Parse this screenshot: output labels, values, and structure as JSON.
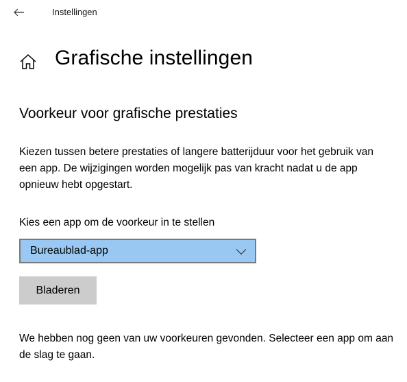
{
  "titlebar": {
    "back_icon": "arrow-left-icon",
    "title": "Instellingen"
  },
  "page": {
    "home_icon": "home-icon",
    "title": "Grafische instellingen"
  },
  "graphics_preference": {
    "section_title": "Voorkeur voor grafische prestaties",
    "description": "Kiezen tussen betere prestaties of langere batterijduur voor het gebruik van een app. De wijzigingen worden mogelijk pas van kracht nadat u de app opnieuw hebt opgestart.",
    "select_label": "Kies een app om de voorkeur in te stellen",
    "selected_app_type": "Bureaublad-app",
    "dropdown_icon": "chevron-down-icon",
    "browse_label": "Bladeren",
    "empty_message": "We hebben nog geen van uw voorkeuren gevonden. Selecteer een app om aan de slag te gaan."
  },
  "colors": {
    "select_background": "#99c9f2",
    "select_border": "#7a7a7a",
    "button_background": "#cccccc"
  }
}
